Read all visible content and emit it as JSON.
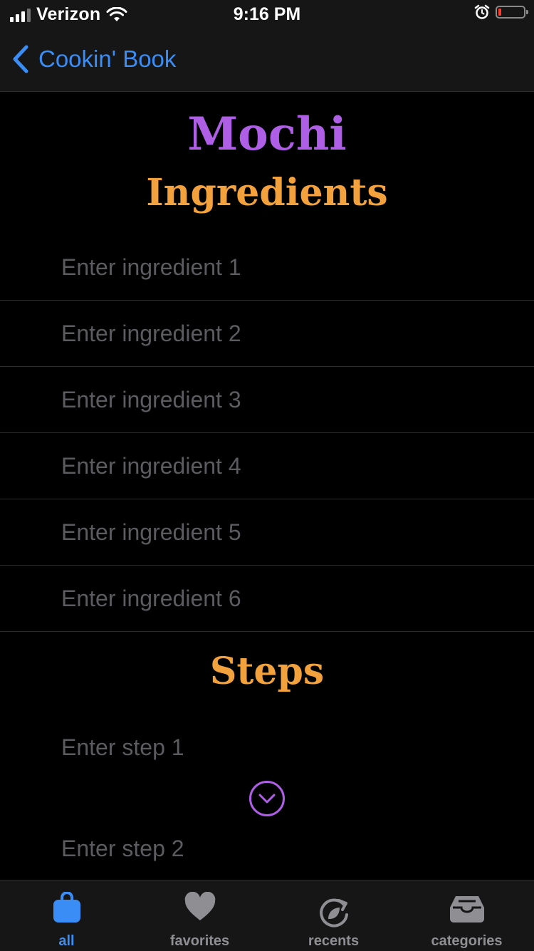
{
  "status_bar": {
    "carrier": "Verizon",
    "time": "9:16 PM",
    "battery_color": "#ff3b30"
  },
  "nav": {
    "back_label": "Cookin' Book",
    "accent_color": "#3a8df5"
  },
  "recipe": {
    "title": "Mochi",
    "title_color": "#af5ee6"
  },
  "ingredients": {
    "heading": "Ingredients",
    "heading_color": "#f2a13c",
    "placeholders": [
      "Enter ingredient 1",
      "Enter ingredient 2",
      "Enter ingredient 3",
      "Enter ingredient 4",
      "Enter ingredient 5",
      "Enter ingredient 6"
    ]
  },
  "steps": {
    "heading": "Steps",
    "placeholders": [
      "Enter step 1",
      "Enter step 2"
    ],
    "expand_icon": "chevron-down-circle-icon"
  },
  "tab_bar": {
    "active": "all",
    "tabs": [
      {
        "label": "all",
        "icon": "bag-icon"
      },
      {
        "label": "favorites",
        "icon": "heart-icon"
      },
      {
        "label": "recents",
        "icon": "refresh-leaf-icon"
      },
      {
        "label": "categories",
        "icon": "tray-icon"
      }
    ]
  }
}
